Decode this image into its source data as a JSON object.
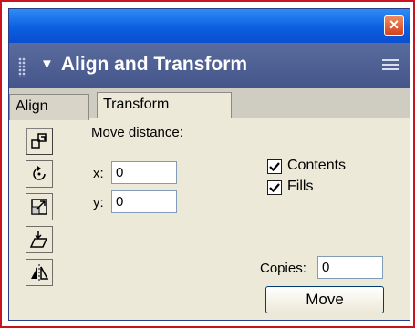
{
  "window": {
    "close_label": "×"
  },
  "panel": {
    "title": "Align and Transform",
    "collapse_arrow": "▼"
  },
  "tabs": [
    {
      "label": "Align"
    },
    {
      "label": "Transform"
    }
  ],
  "sidebar": {
    "tools": [
      "move-icon",
      "rotate-icon",
      "scale-icon",
      "skew-icon",
      "reflect-icon"
    ]
  },
  "transform": {
    "move_distance_label": "Move distance:",
    "x_label": "x:",
    "x_value": "0",
    "y_label": "y:",
    "y_value": "0",
    "contents_label": "Contents",
    "contents_checked": true,
    "fills_label": "Fills",
    "fills_checked": true,
    "copies_label": "Copies:",
    "copies_value": "0",
    "move_button": "Move"
  }
}
